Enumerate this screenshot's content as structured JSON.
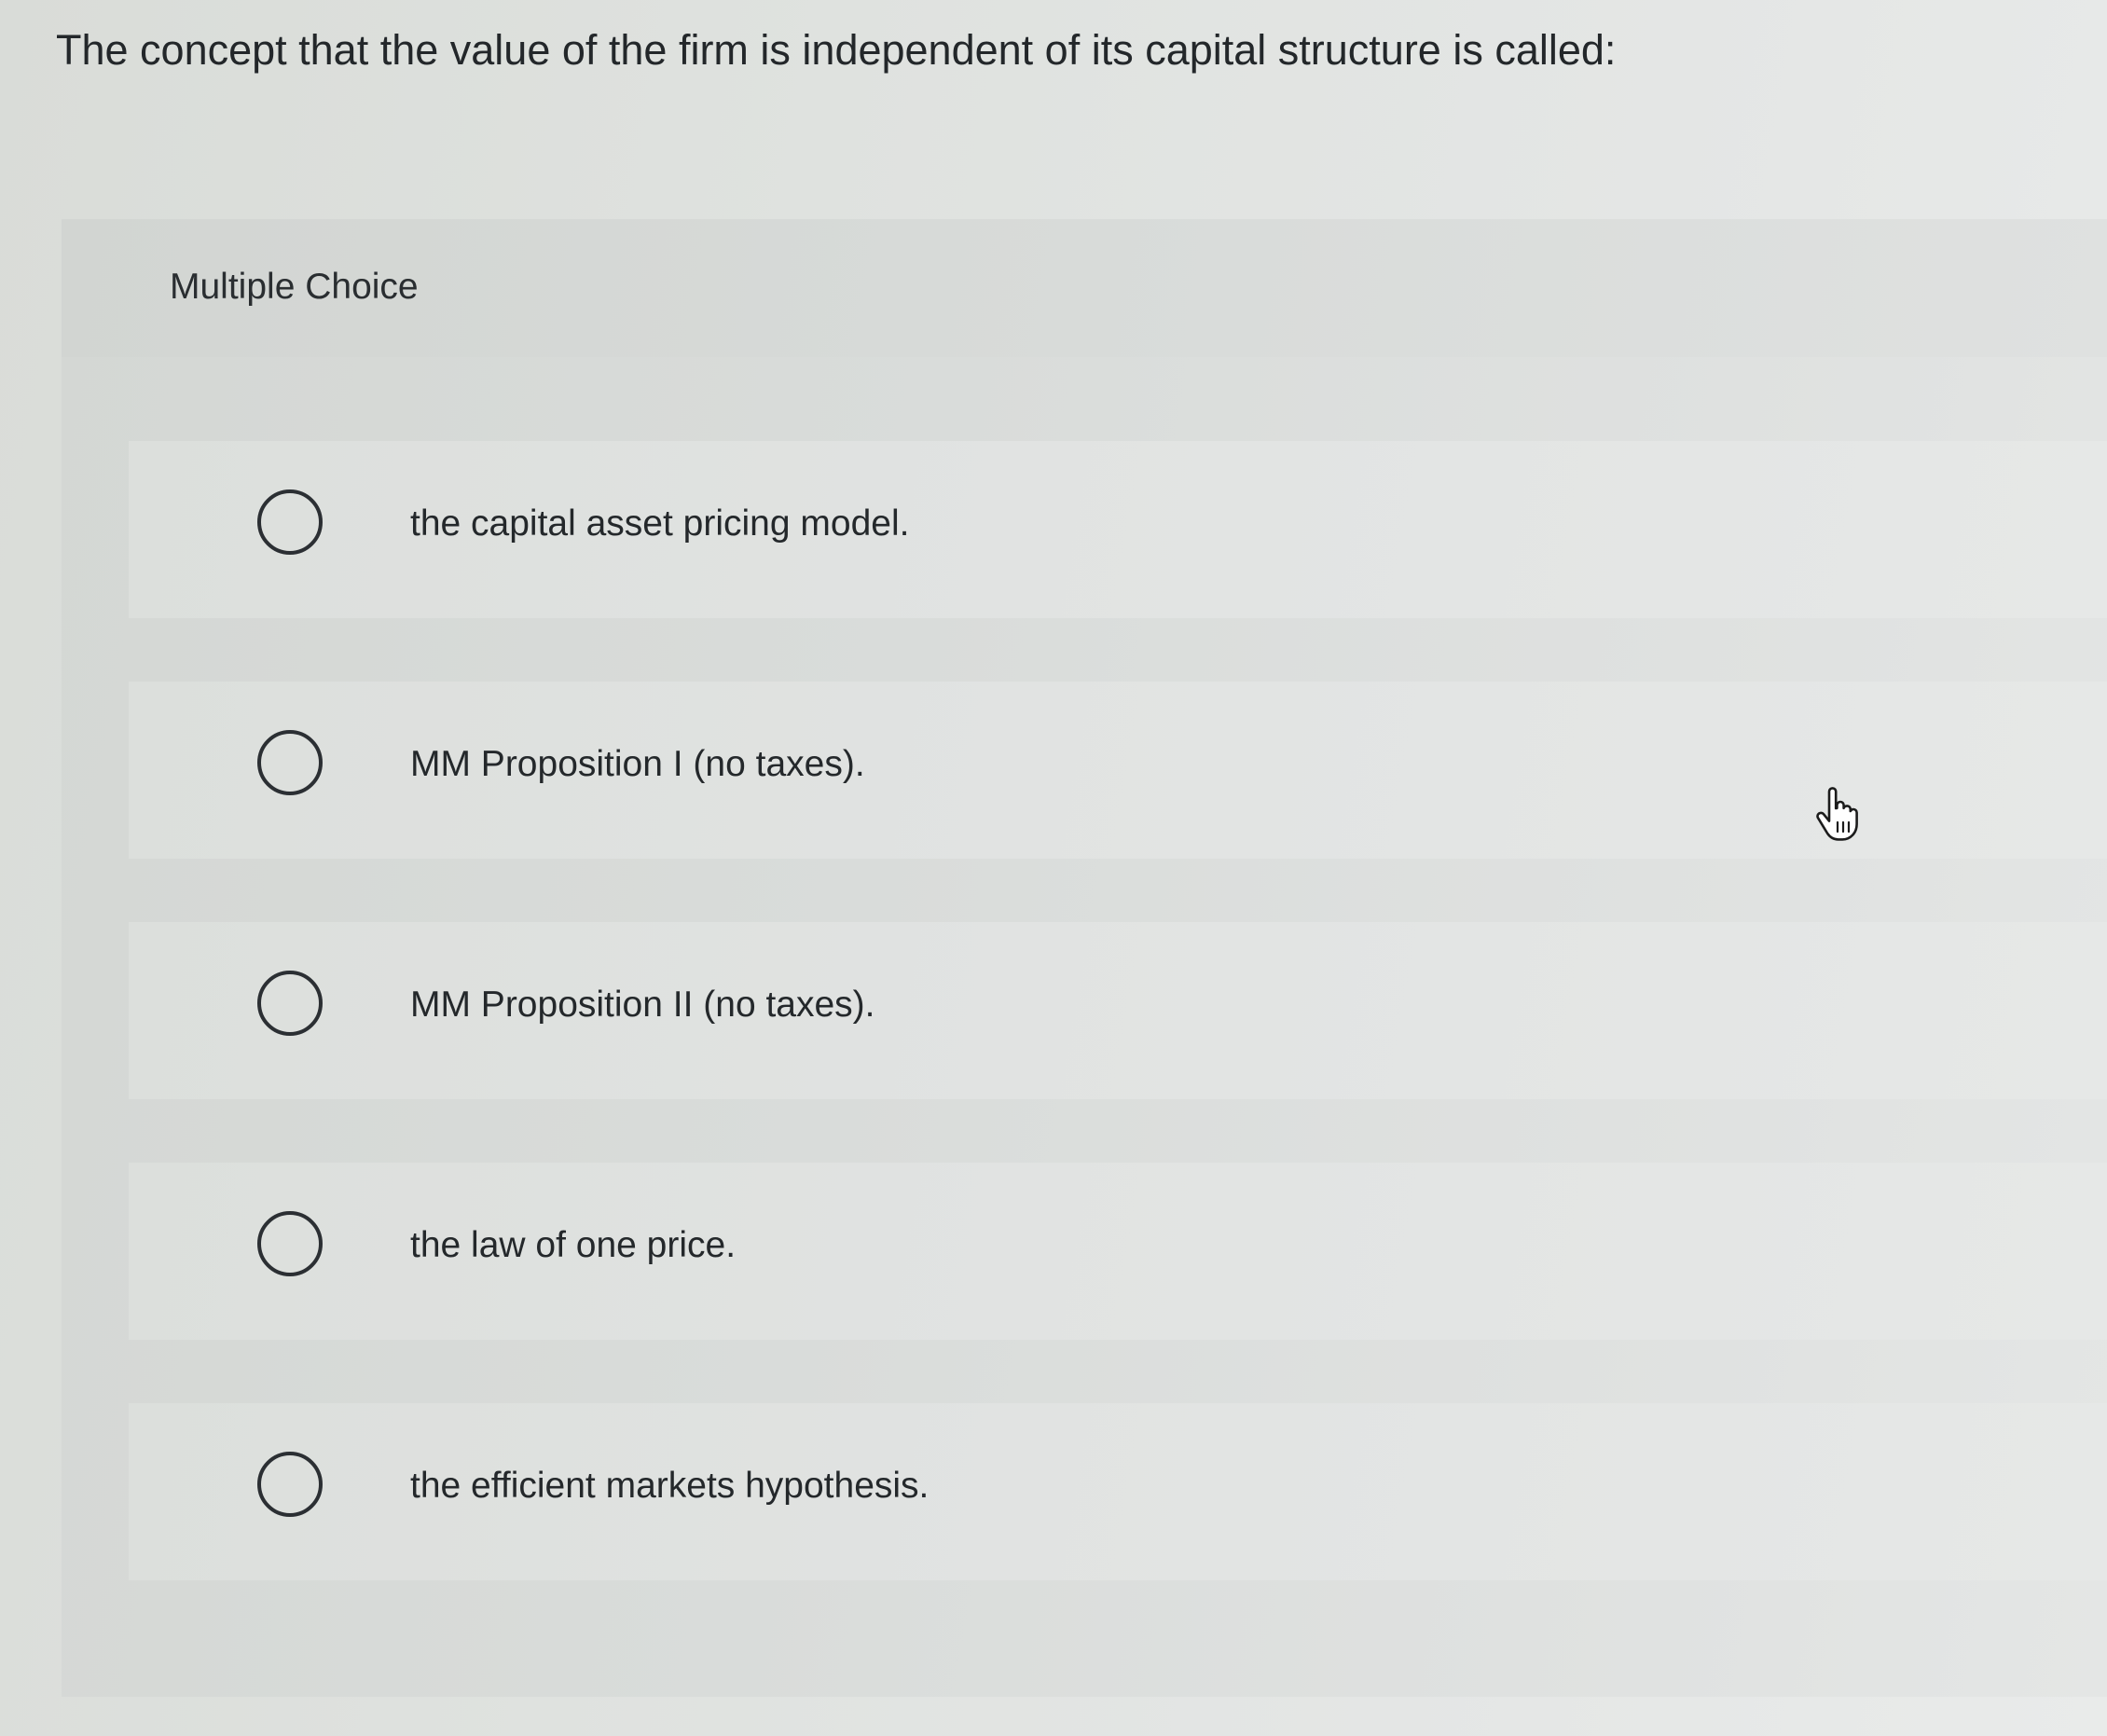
{
  "question": {
    "text": "The concept that the value of the firm is independent of its capital structure is called:"
  },
  "panel": {
    "label": "Multiple Choice"
  },
  "options": [
    {
      "label": "the capital asset pricing model.",
      "selected": false
    },
    {
      "label": "MM Proposition I (no taxes).",
      "selected": false
    },
    {
      "label": "MM Proposition II (no taxes).",
      "selected": false
    },
    {
      "label": "the law of one price.",
      "selected": false
    },
    {
      "label": "the efficient markets hypothesis.",
      "selected": false
    }
  ],
  "icons": {
    "radio": "radio-button-icon",
    "cursor": "hand-pointer-icon"
  }
}
